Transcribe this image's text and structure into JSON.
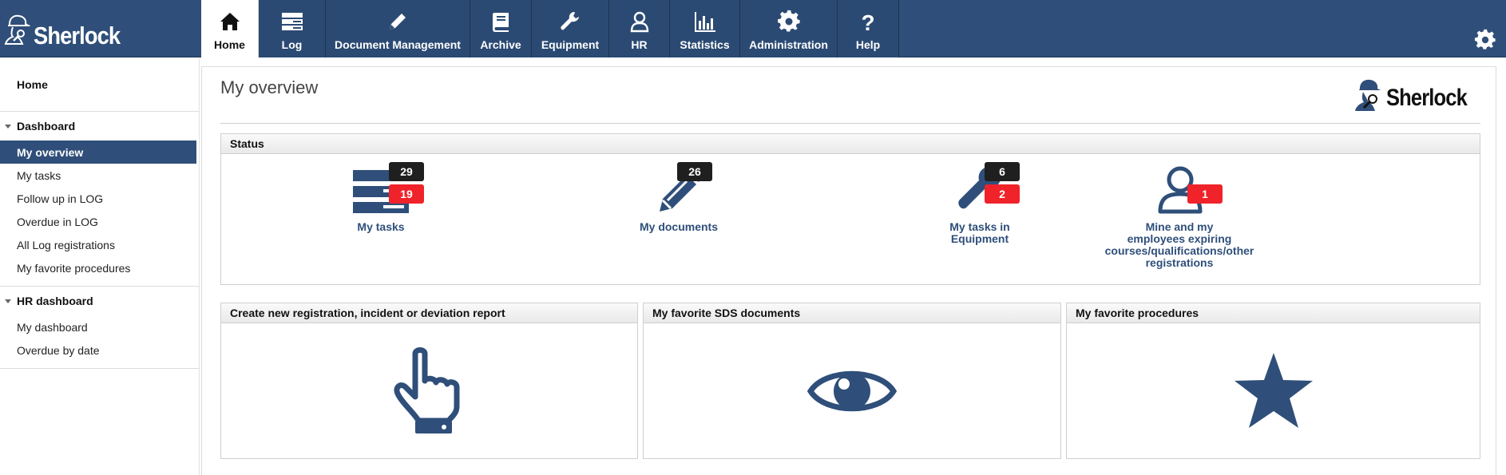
{
  "brand": {
    "name": "Sherlock"
  },
  "nav": [
    {
      "label": "Home",
      "icon": "home-icon",
      "active": true
    },
    {
      "label": "Log",
      "icon": "log-icon"
    },
    {
      "label": "Document Management",
      "icon": "pencil-icon"
    },
    {
      "label": "Archive",
      "icon": "book-icon"
    },
    {
      "label": "Equipment",
      "icon": "wrench-icon"
    },
    {
      "label": "HR",
      "icon": "user-icon"
    },
    {
      "label": "Statistics",
      "icon": "bar-chart-icon"
    },
    {
      "label": "Administration",
      "icon": "gear-icon"
    },
    {
      "label": "Help",
      "icon": "question-icon"
    }
  ],
  "sidebar": {
    "top": "Home",
    "dashboard": {
      "title": "Dashboard",
      "items": [
        "My overview",
        "My tasks",
        "Follow up in LOG",
        "Overdue in LOG",
        "All Log registrations",
        "My favorite procedures"
      ]
    },
    "hr_dashboard": {
      "title": "HR dashboard",
      "items": [
        "My dashboard",
        "Overdue by date"
      ]
    }
  },
  "main": {
    "title": "My overview",
    "logo_text": "Sherlock",
    "status": {
      "header": "Status",
      "tiles": [
        {
          "label": "My tasks",
          "badge_dark": "29",
          "badge_red": "19"
        },
        {
          "label": "My documents",
          "badge_dark": "26"
        },
        {
          "label_lines": [
            "My tasks in",
            "Equipment"
          ],
          "badge_dark": "6",
          "badge_red": "2"
        },
        {
          "label_lines": [
            "Mine and my",
            "employees expiring",
            "courses/qualifications/other",
            "registrations"
          ],
          "badge_red": "1"
        }
      ]
    },
    "panels": {
      "create": "Create new registration, incident or deviation report",
      "sds": "My favorite SDS documents",
      "procedures": "My favorite procedures"
    }
  },
  "colors": {
    "brand_blue": "#2f4f7a",
    "badge_red": "#f0232a",
    "badge_dark": "#1f1f1f"
  }
}
